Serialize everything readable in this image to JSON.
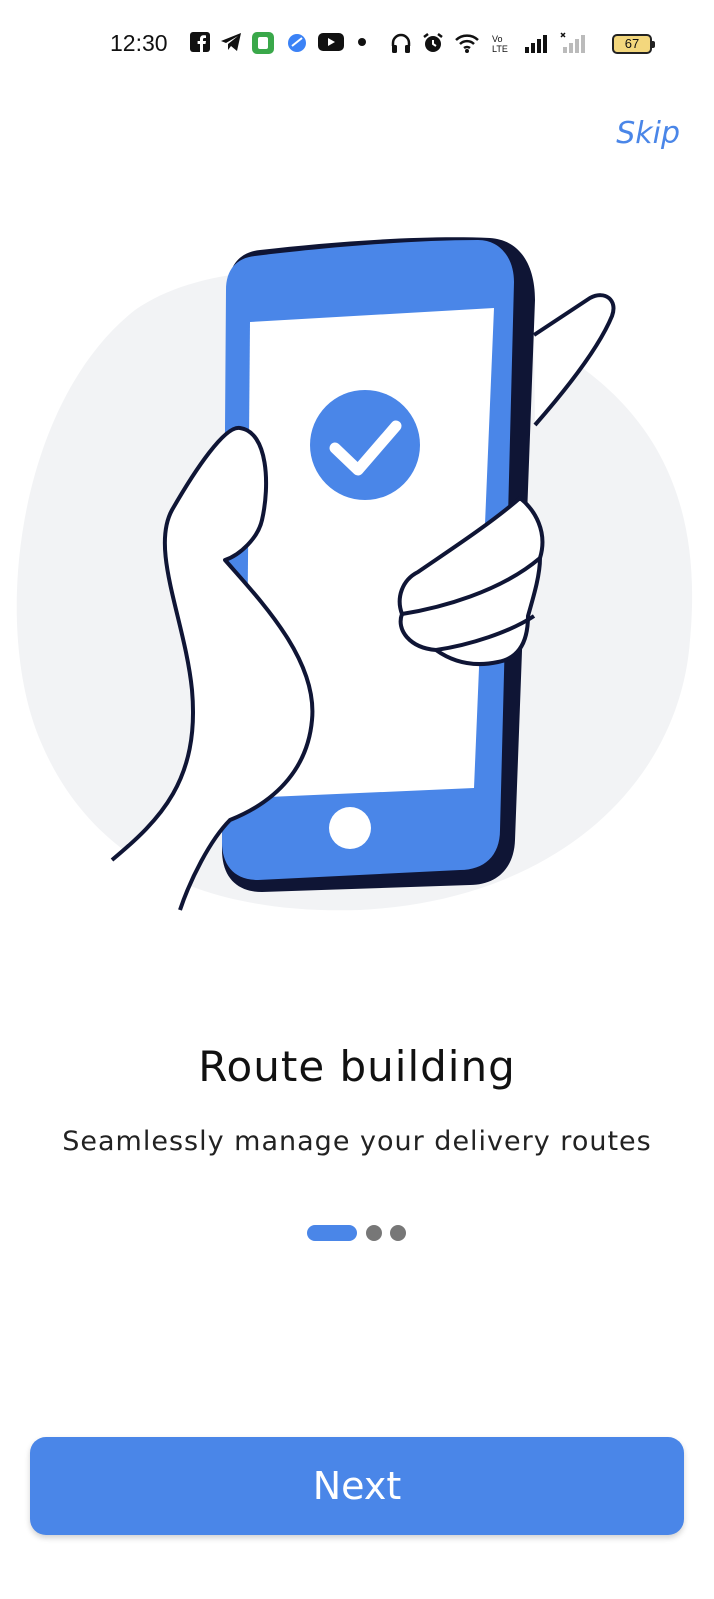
{
  "status_bar": {
    "time": "12:30",
    "icons": [
      "facebook-icon",
      "telegram-icon",
      "app-icon",
      "app-blue-icon",
      "youtube-icon",
      "dot-icon",
      "headphones-icon",
      "alarm-icon",
      "wifi-icon",
      "volte-icon",
      "signal-icon",
      "signal-weak-icon"
    ],
    "battery": "67"
  },
  "skip_label": "Skip",
  "illustration": {
    "icon": "phone-in-hand-checkmark-illustration",
    "colors": {
      "phone": "#4a86e8",
      "outline": "#0f1535",
      "blob": "#f2f3f5"
    }
  },
  "content": {
    "title": "Route building",
    "subtitle": "Seamlessly manage your delivery routes"
  },
  "pager": {
    "count": 3,
    "active_index": 0
  },
  "next_label": "Next",
  "colors": {
    "accent": "#4a86e8",
    "dot_inactive": "#777777"
  }
}
